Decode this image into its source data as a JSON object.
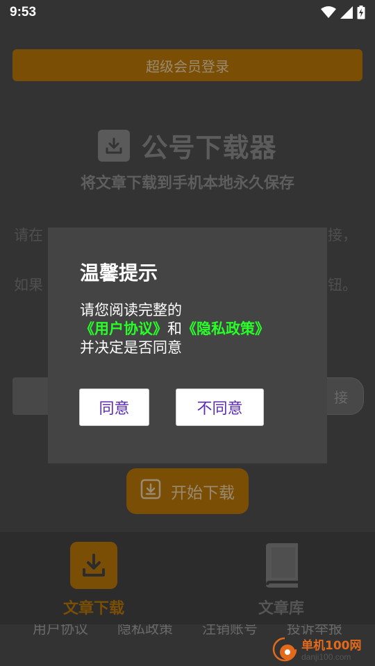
{
  "status_bar": {
    "time": "9:53",
    "icons": [
      "wifi-icon",
      "cell-signal-icon",
      "battery-charging-icon"
    ]
  },
  "main": {
    "vip_login_label": "超级会员登录",
    "brand_title": "公号下载器",
    "subtitle": "将文章下载到手机本地永久保存",
    "instruction_line1": "请在",
    "instruction_line1_end": "接，",
    "instruction_line2": "如果",
    "instruction_line2_end": "钮。",
    "paste_button_label": "接",
    "start_download_label": "开始下载"
  },
  "dialog": {
    "title": "温馨提示",
    "body_prefix": "请您阅读完整的",
    "user_agreement_link": "《用户协议》",
    "conjunction": "和",
    "privacy_policy_link": "《隐私政策》",
    "body_suffix": "并决定是否同意",
    "agree_label": "同意",
    "disagree_label": "不同意"
  },
  "bottom_nav": {
    "items": [
      {
        "label": "文章下载",
        "icon": "download-icon",
        "active": true
      },
      {
        "label": "文章库",
        "icon": "book-icon",
        "active": false
      }
    ]
  },
  "footer": {
    "links": [
      "用户协议",
      "隐私政策",
      "注销账号",
      "投诉举报"
    ]
  },
  "watermark": {
    "cn": "单机100网",
    "en": "danji100.com"
  },
  "colors": {
    "accent": "#7a4f05",
    "link_green": "#27ff27",
    "button_text_purple": "#5b2bb5",
    "dialog_bg": "#444444"
  }
}
